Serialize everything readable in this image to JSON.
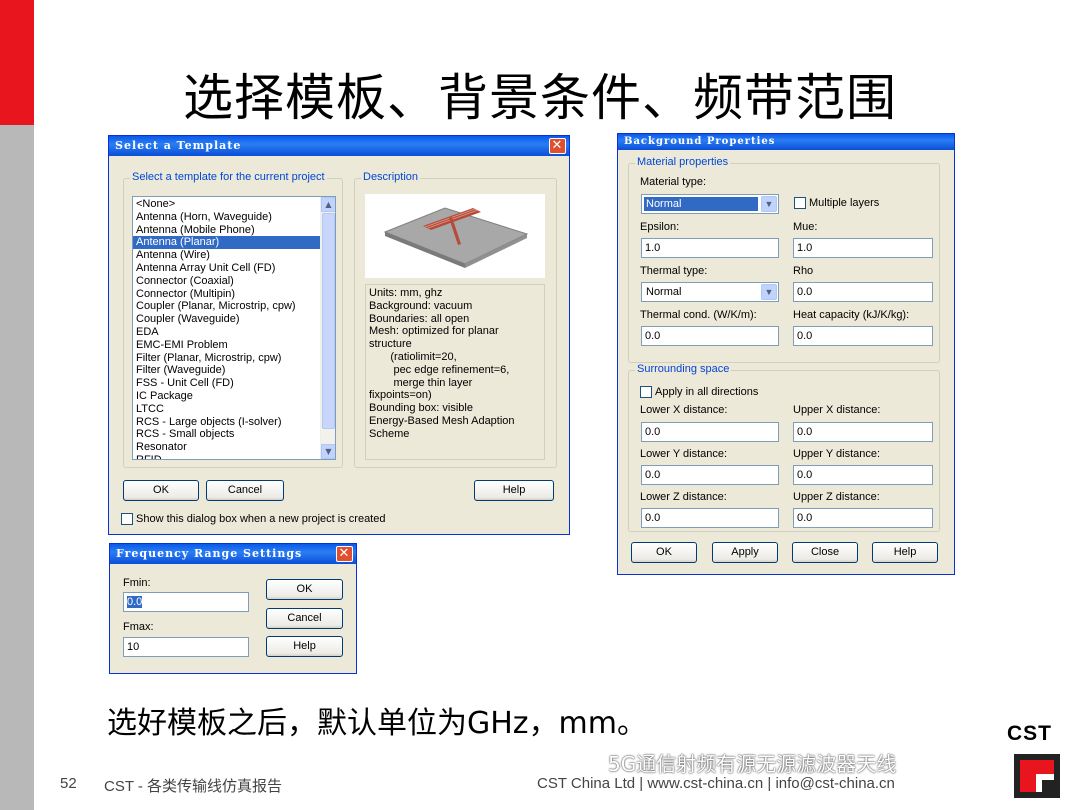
{
  "slide": {
    "title": "选择模板、背景条件、频带范围",
    "bottom_text": "选好模板之后，默认单位为GHz，mm。",
    "page_number": "52",
    "footer_left": "CST - 各类传输线仿真报告",
    "footer_right": "CST China Ltd | www.cst-china.cn | info@cst-china.cn",
    "watermark": "5G通信射频有源无源滤波器天线",
    "logo": "CST"
  },
  "template_dialog": {
    "title": "Select a Template",
    "list_legend": "Select a template for the current project",
    "desc_legend": "Description",
    "items": [
      "<None>",
      "Antenna (Horn, Waveguide)",
      "Antenna (Mobile Phone)",
      "Antenna (Planar)",
      "Antenna (Wire)",
      "Antenna Array Unit Cell (FD)",
      "Connector (Coaxial)",
      "Connector (Multipin)",
      "Coupler (Planar, Microstrip, cpw)",
      "Coupler (Waveguide)",
      "EDA",
      "EMC-EMI Problem",
      "Filter (Planar, Microstrip, cpw)",
      "Filter (Waveguide)",
      "FSS - Unit Cell (FD)",
      "IC Package",
      "LTCC",
      "RCS - Large objects (I-solver)",
      "RCS - Small objects",
      "Resonator",
      "RFID"
    ],
    "selected_index": 3,
    "description": "Units: mm, ghz\nBackground: vacuum\nBoundaries: all open\nMesh: optimized for planar\nstructure\n       (ratiolimit=20,\n        pec edge refinement=6,\n        merge thin layer\nfixpoints=on)\nBounding box: visible\nEnergy-Based Mesh Adaption\nScheme",
    "ok_label": "OK",
    "cancel_label": "Cancel",
    "help_label": "Help",
    "show_checkbox_label": "Show this dialog box when a new project is created"
  },
  "background_dialog": {
    "title": "Background Properties",
    "material_legend": "Material properties",
    "material_type_label": "Material type:",
    "material_type_value": "Normal",
    "multiple_layers_label": "Multiple layers",
    "epsilon_label": "Epsilon:",
    "epsilon_value": "1.0",
    "mue_label": "Mue:",
    "mue_value": "1.0",
    "thermal_type_label": "Thermal type:",
    "thermal_type_value": "Normal",
    "rho_label": "Rho",
    "rho_value": "0.0",
    "thermal_cond_label": "Thermal cond. (W/K/m):",
    "thermal_cond_value": "0.0",
    "heat_capacity_label": "Heat capacity (kJ/K/kg):",
    "heat_capacity_value": "0.0",
    "surrounding_legend": "Surrounding space",
    "apply_all_label": "Apply in all directions",
    "lower_x_label": "Lower X distance:",
    "lower_x_value": "0.0",
    "upper_x_label": "Upper X distance:",
    "upper_x_value": "0.0",
    "lower_y_label": "Lower Y distance:",
    "lower_y_value": "0.0",
    "upper_y_label": "Upper Y distance:",
    "upper_y_value": "0.0",
    "lower_z_label": "Lower Z distance:",
    "lower_z_value": "0.0",
    "upper_z_label": "Upper Z distance:",
    "upper_z_value": "0.0",
    "ok_label": "OK",
    "apply_label": "Apply",
    "close_label": "Close",
    "help_label": "Help"
  },
  "frequency_dialog": {
    "title": "Frequency Range Settings",
    "fmin_label": "Fmin:",
    "fmin_value": "0.0",
    "fmax_label": "Fmax:",
    "fmax_value": "10",
    "ok_label": "OK",
    "cancel_label": "Cancel",
    "help_label": "Help"
  },
  "colors": {
    "accent_red": "#e8141e",
    "titlebar_blue": "#0a5ae8",
    "selection_blue": "#316ac5"
  }
}
